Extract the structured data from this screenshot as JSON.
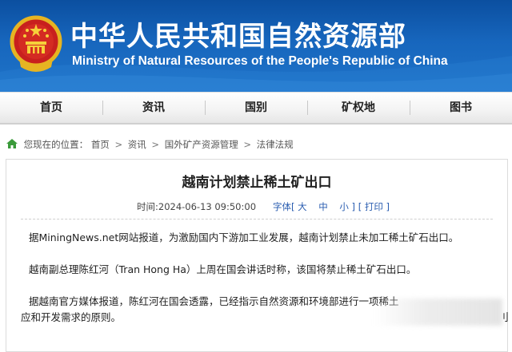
{
  "header": {
    "title_zh": "中华人民共和国自然资源部",
    "title_en": "Ministry of Natural Resources of the People's Republic of China",
    "emblem_icon": "national-emblem-icon",
    "bg_color": "#1766bd"
  },
  "nav": {
    "items": [
      {
        "label": "首页"
      },
      {
        "label": "资讯"
      },
      {
        "label": "国别"
      },
      {
        "label": "矿权地"
      },
      {
        "label": "图书"
      }
    ]
  },
  "breadcrumb": {
    "prefix": "您现在的位置：",
    "items": [
      "首页",
      "资讯",
      "国外矿产资源管理",
      "法律法规"
    ],
    "separator": ">"
  },
  "article": {
    "title": "越南计划禁止稀土矿出口",
    "time": "时间:2024-06-13 09:50:00",
    "font_size_label": "字体",
    "font_sizes": [
      "大",
      "中",
      "小"
    ],
    "print_label": "打印",
    "paragraphs": [
      "据MiningNews.net网站报道，为激励国内下游加工业发展，越南计划禁止未加工稀土矿石出口。",
      "越南副总理陈红河（Tran Hong Ha）上周在国会讲话时称，该国将禁止稀土矿石出口。",
      "据越南官方媒体报道，陈红河在国会透露，已经指示自然资源和环境部进行一项稀土",
      "应和开发需求的原则。"
    ],
    "edge_glyph": "刂"
  }
}
